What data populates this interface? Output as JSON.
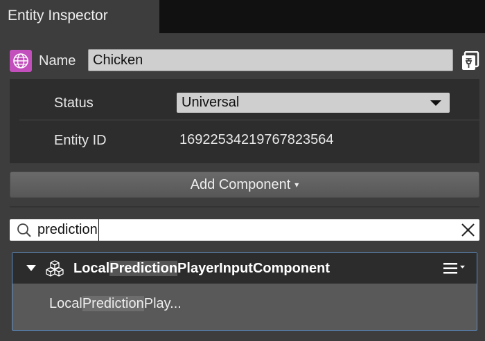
{
  "window": {
    "tab_title": "Entity Inspector"
  },
  "name_row": {
    "label": "Name",
    "value": "Chicken"
  },
  "properties": {
    "status_label": "Status",
    "status_value": "Universal",
    "entity_id_label": "Entity ID",
    "entity_id_value": "16922534219767823564"
  },
  "add_component": {
    "label": "Add Component",
    "arrow": "▾"
  },
  "search": {
    "value": "prediction"
  },
  "component": {
    "title_pre": "Local",
    "title_match": "Prediction",
    "title_post": "PlayerInputComponent",
    "body_pre": "Local",
    "body_match": "Prediction",
    "body_post": "Play..."
  },
  "colors": {
    "entity_icon": "#c24fbc",
    "card_border": "#5f8fc8",
    "background": "#3d3d3d"
  },
  "icons": [
    "globe-entity-icon",
    "pin-icon",
    "dropdown-caret-icon",
    "search-icon",
    "clear-icon",
    "expand-arrow-icon",
    "component-cubes-icon",
    "hamburger-menu-icon"
  ]
}
